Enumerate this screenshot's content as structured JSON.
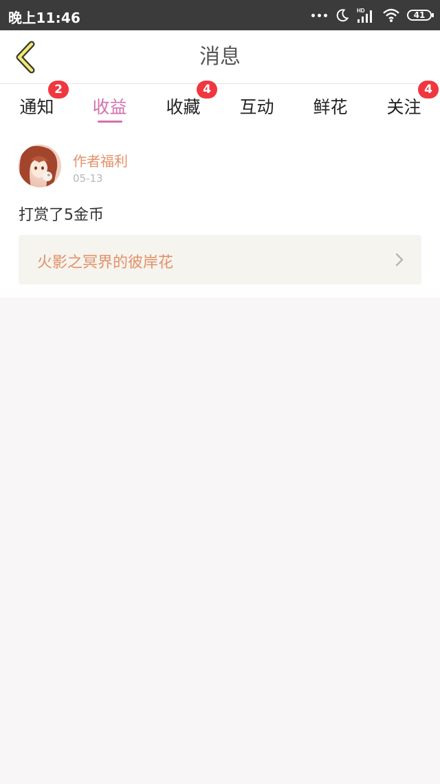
{
  "status_bar": {
    "time": "晚上11:46",
    "network_badge": "HD",
    "battery_level": "41",
    "icons": [
      "more-dots-icon",
      "moon-icon",
      "signal-icon",
      "wifi-icon",
      "battery-icon"
    ]
  },
  "header": {
    "title": "消息",
    "back_icon": "chevron-left-icon"
  },
  "tabs": [
    {
      "label": "通知",
      "badge": "2"
    },
    {
      "label": "收益",
      "badge": null,
      "active": true
    },
    {
      "label": "收藏",
      "badge": "4"
    },
    {
      "label": "互动",
      "badge": null
    },
    {
      "label": "鲜花",
      "badge": null
    },
    {
      "label": "关注",
      "badge": "4"
    }
  ],
  "message": {
    "author": "作者福利",
    "date": "05-13",
    "text": "打赏了5金币",
    "link_title": "火影之冥界的彼岸花",
    "link_icon": "chevron-right-icon"
  },
  "colors": {
    "accent": "#d46fae",
    "badge": "#f0373f",
    "author_text": "#e49068",
    "status_bar_bg": "#3b3b3b",
    "page_bg": "#f8f6f7"
  }
}
